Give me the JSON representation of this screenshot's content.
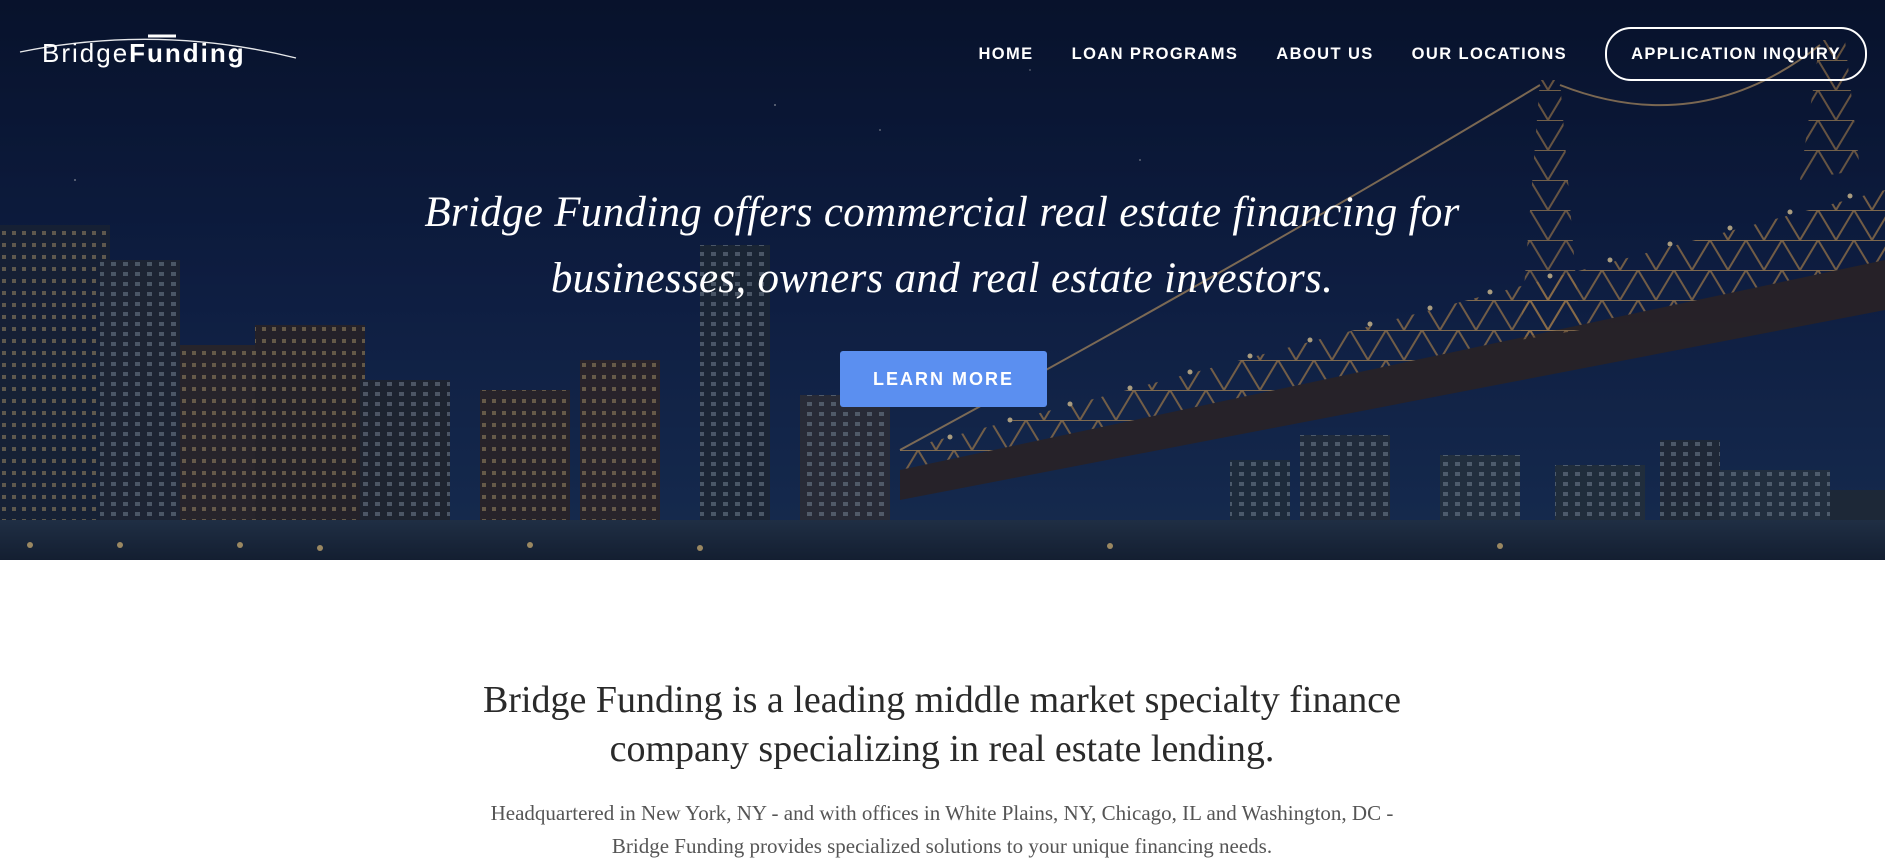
{
  "brand": {
    "name_light": "Bridge",
    "name_bold": "Funding"
  },
  "nav": {
    "items": [
      {
        "label": "HOME"
      },
      {
        "label": "LOAN PROGRAMS"
      },
      {
        "label": "ABOUT US"
      },
      {
        "label": "OUR LOCATIONS"
      }
    ],
    "cta_label": "APPLICATION INQUIRY"
  },
  "hero": {
    "headline_line1": "Bridge Funding offers commercial real estate financing for",
    "headline_line2": "businesses, owners and real estate investors.",
    "button_label": "LEARN MORE",
    "background": "night city skyline with illuminated bridge"
  },
  "intro": {
    "title_line1": "Bridge Funding is a leading middle market specialty finance",
    "title_line2": "company specializing in real estate lending.",
    "body_line1": "Headquartered in New York, NY - and with offices in White Plains, NY, Chicago, IL and Washington, DC -",
    "body_line2": "Bridge Funding provides specialized solutions to your unique financing needs."
  },
  "colors": {
    "accent_button": "#5b8ff0",
    "hero_night": "#0b1634",
    "text_dark": "#2a2a2a",
    "text_muted": "#555555"
  }
}
